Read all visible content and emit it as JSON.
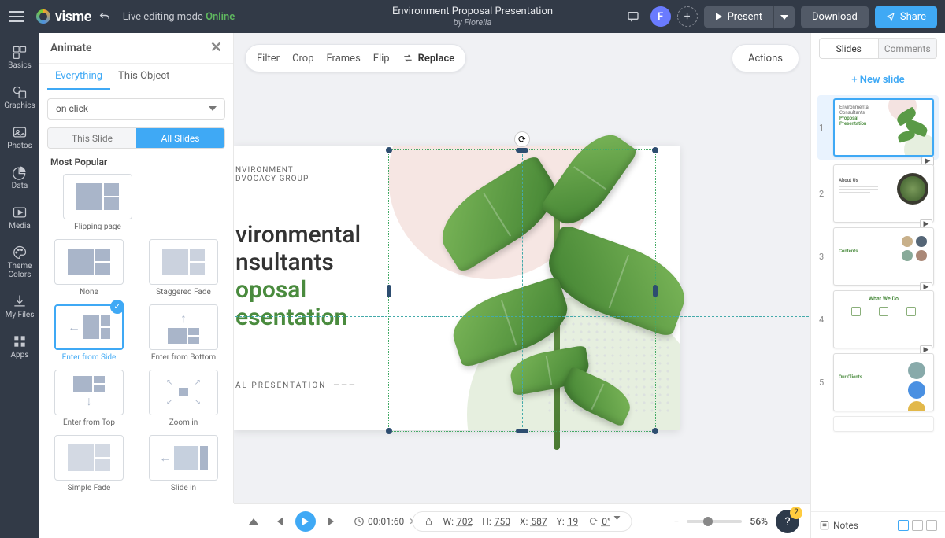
{
  "topbar": {
    "brand": "visme",
    "editing_mode_label": "Live editing mode",
    "editing_mode_status": "Online",
    "title": "Environment Proposal Presentation",
    "byline": "by Fiorella",
    "avatar_initial": "F",
    "present_label": "Present",
    "download_label": "Download",
    "share_label": "Share"
  },
  "rail": {
    "basics": "Basics",
    "graphics": "Graphics",
    "photos": "Photos",
    "data": "Data",
    "media": "Media",
    "theme_colors": "Theme\nColors",
    "my_files": "My Files",
    "apps": "Apps"
  },
  "animate_panel": {
    "title": "Animate",
    "tab_everything": "Everything",
    "tab_this_object": "This Object",
    "trigger": "on click",
    "scope_this_slide": "This Slide",
    "scope_all_slides": "All Slides",
    "section_most_popular": "Most Popular",
    "items": {
      "flipping_page": "Flipping page",
      "none": "None",
      "staggered_fade": "Staggered Fade",
      "enter_from_side": "Enter from Side",
      "enter_from_bottom": "Enter from Bottom",
      "enter_from_top": "Enter from Top",
      "zoom_in": "Zoom in",
      "simple_fade": "Simple Fade",
      "slide_in": "Slide in"
    }
  },
  "context_toolbar": {
    "filter": "Filter",
    "crop": "Crop",
    "frames": "Frames",
    "flip": "Flip",
    "replace": "Replace"
  },
  "actions_button": "Actions",
  "slide_content": {
    "org_line1": "NVIRONMENT",
    "org_line2": "DVOCACY GROUP",
    "title_line1": "vironmental",
    "title_line2": "nsultants",
    "title_line3": "oposal",
    "title_line4": "esentation",
    "footer": "AL PRESENTATION"
  },
  "right_panel": {
    "tab_slides": "Slides",
    "tab_comments": "Comments",
    "new_slide": "New slide",
    "notes_label": "Notes",
    "thumbs": {
      "t1_line1": "Environmental",
      "t1_line2": "Consultants",
      "t1_line3": "Proposal",
      "t1_line4": "Presentation",
      "t2_title": "About Us",
      "t3_title": "Contents",
      "t4_title": "What We Do",
      "t5_title": "Our Clients"
    }
  },
  "bottom_bar": {
    "time": "00:01:60",
    "w_label": "W:",
    "w_value": "702",
    "h_label": "H:",
    "h_value": "750",
    "x_label": "X:",
    "x_value": "587",
    "y_label": "Y:",
    "y_value": "19",
    "rotation": "0°",
    "zoom": "56%",
    "help_badge": "2"
  }
}
